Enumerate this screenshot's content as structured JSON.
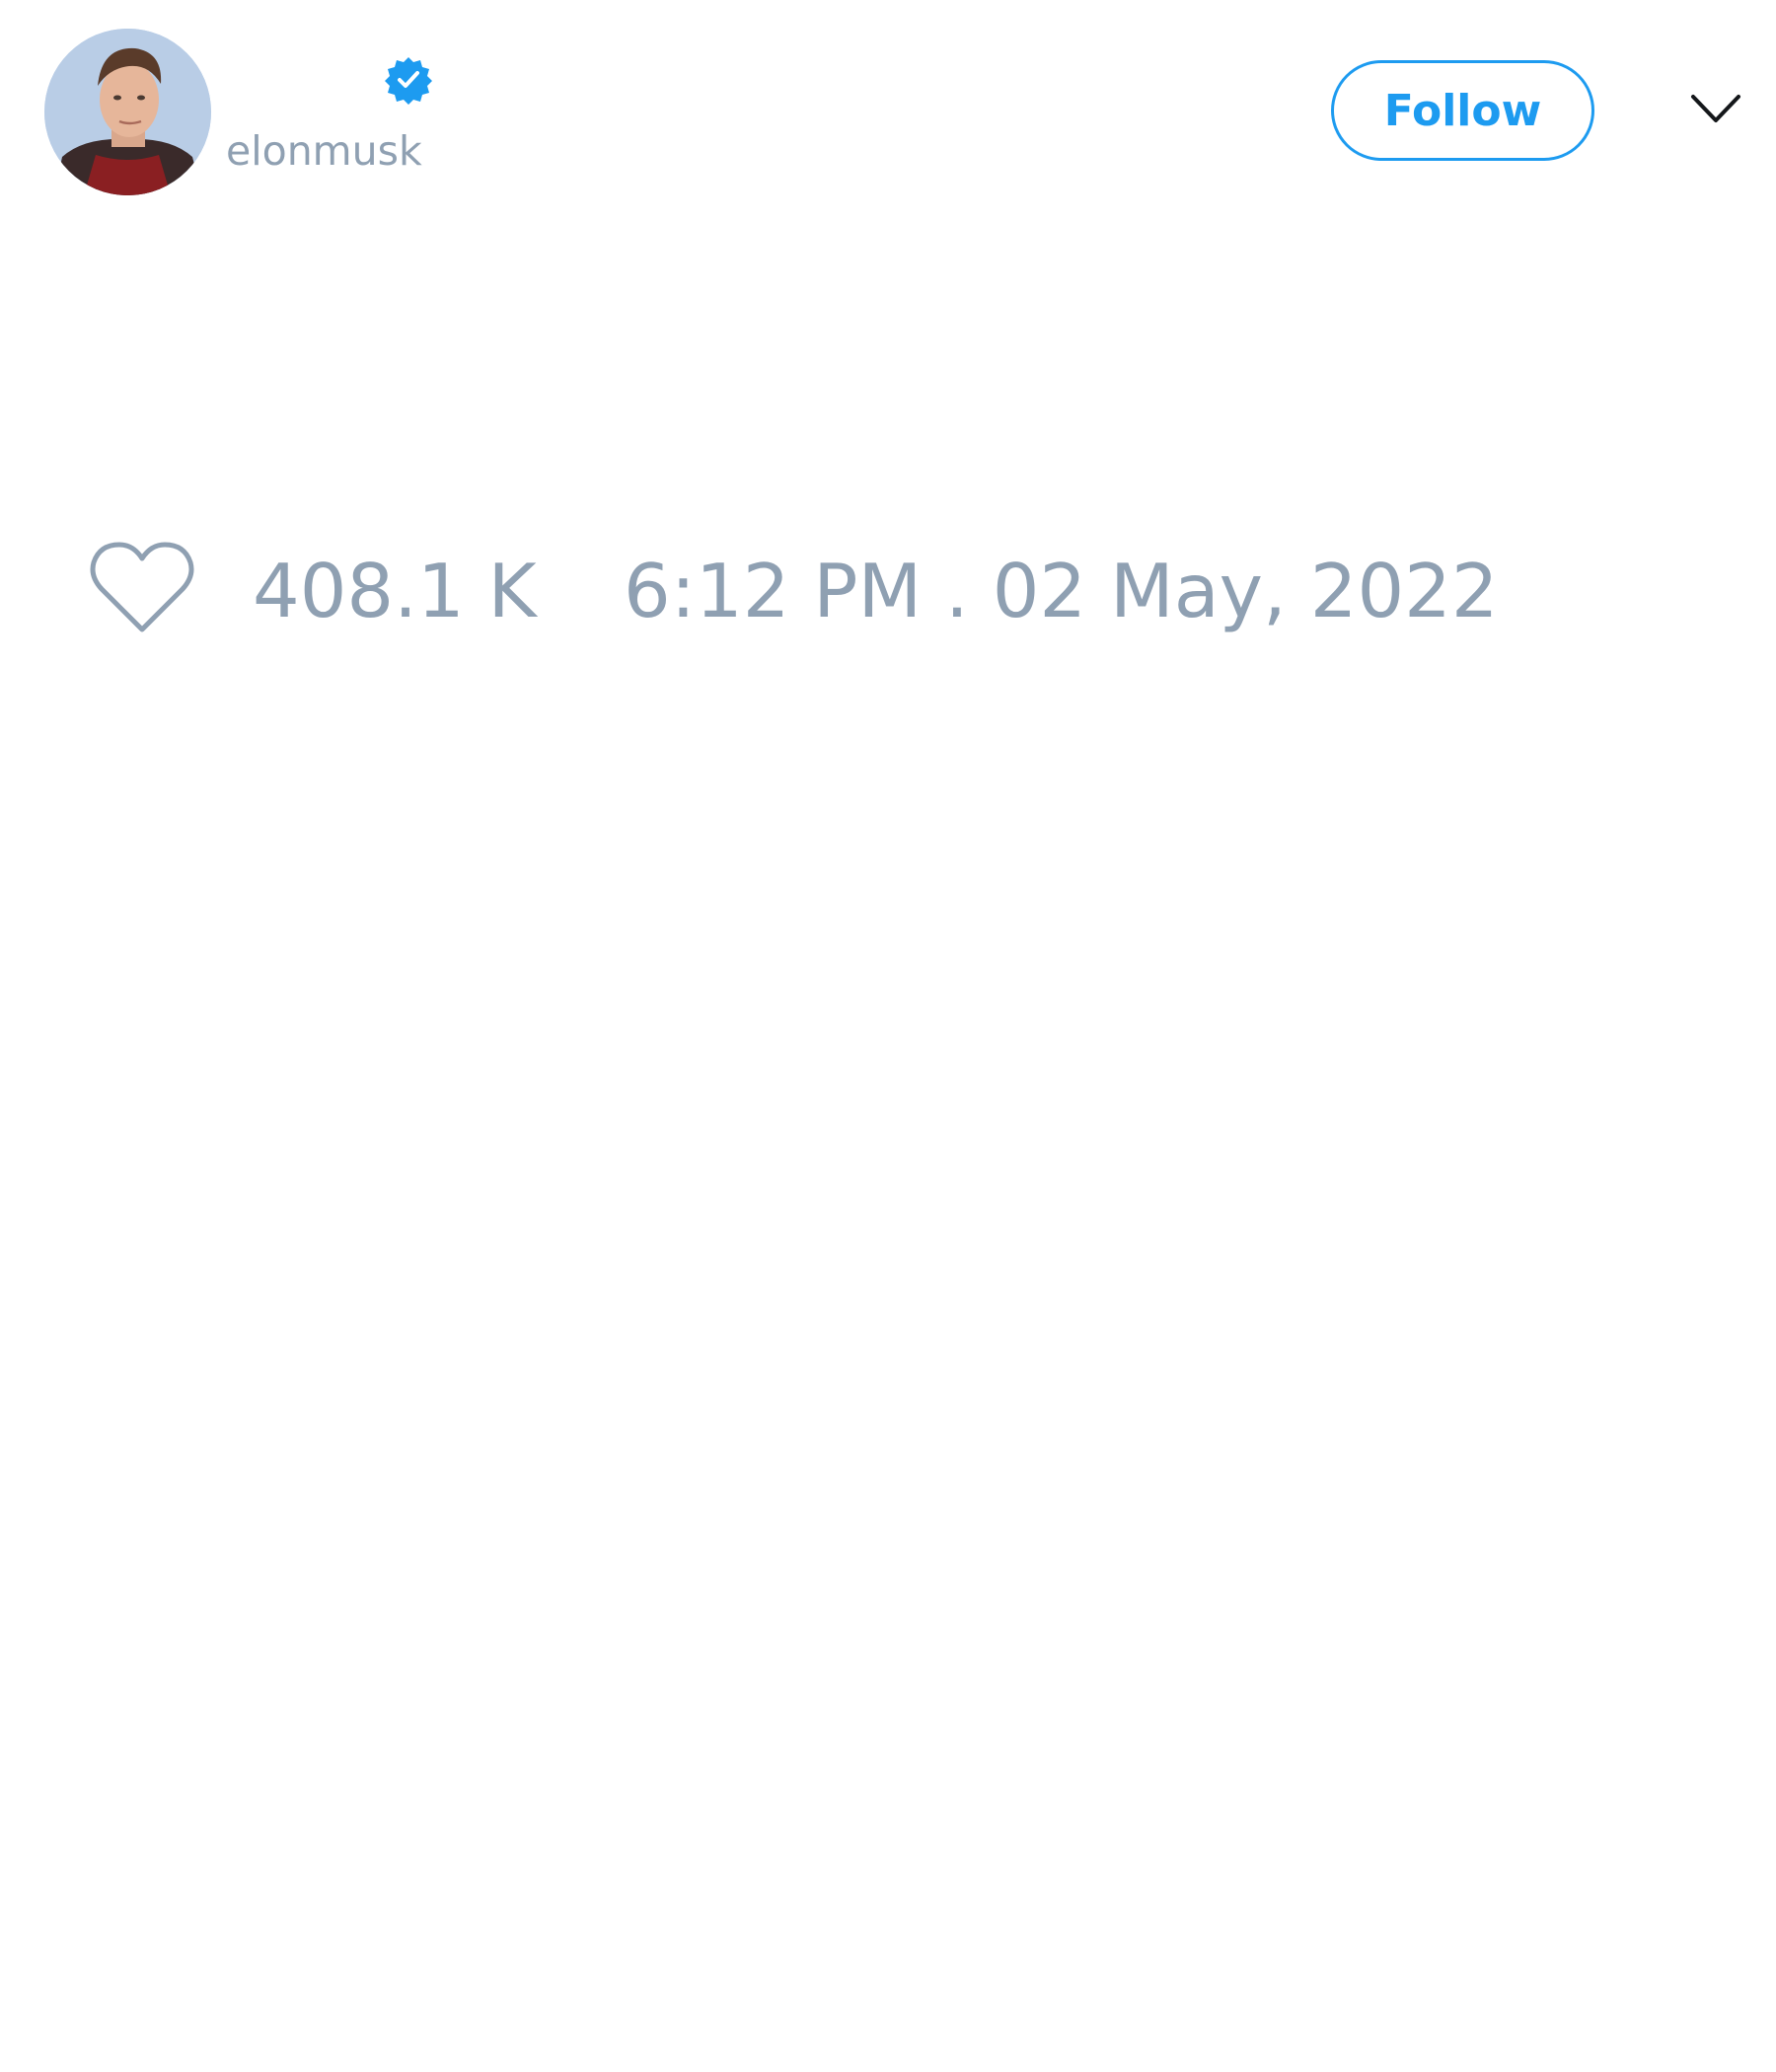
{
  "tweet": {
    "author": {
      "display_name": "",
      "handle": "elonmusk",
      "verified": true
    },
    "follow_label": "Follow",
    "like_count": "408.1 K",
    "timestamp": "6:12 PM . 02 May, 2022"
  },
  "icons": {
    "verified": "verified-badge-icon",
    "more": "chevron-down-icon",
    "like": "heart-outline-icon"
  },
  "colors": {
    "accent": "#1d9bf0",
    "muted_text": "#8fa0b2",
    "background": "#ffffff"
  }
}
